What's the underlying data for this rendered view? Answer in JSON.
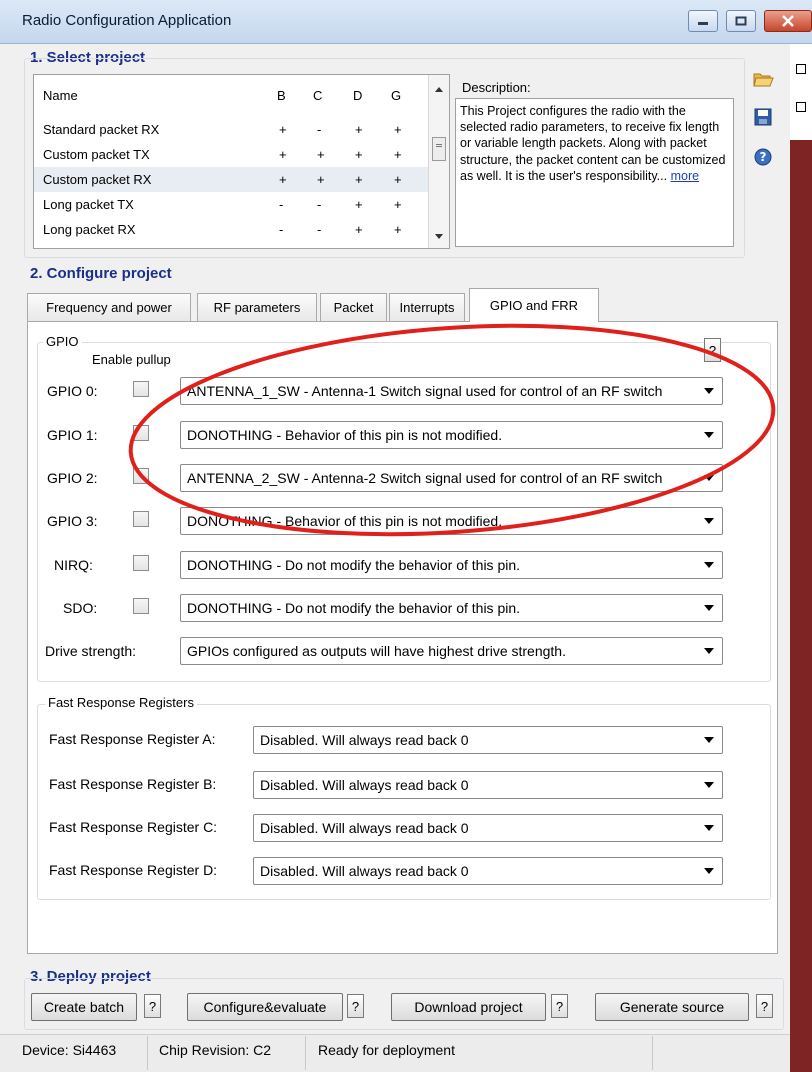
{
  "window": {
    "title": "Radio Configuration Application"
  },
  "section1": {
    "title": "1. Select project"
  },
  "project_list": {
    "headers": [
      "Name",
      "B",
      "C",
      "D",
      "G"
    ],
    "rows": [
      {
        "name": "Standard packet RX",
        "b": "+",
        "c": "-",
        "d": "+",
        "g": "+"
      },
      {
        "name": "Custom packet TX",
        "b": "+",
        "c": "+",
        "d": "+",
        "g": "+"
      },
      {
        "name": "Custom packet RX",
        "b": "+",
        "c": "+",
        "d": "+",
        "g": "+"
      },
      {
        "name": "Long packet TX",
        "b": "-",
        "c": "-",
        "d": "+",
        "g": "+"
      },
      {
        "name": "Long packet RX",
        "b": "-",
        "c": "-",
        "d": "+",
        "g": "+"
      }
    ]
  },
  "description": {
    "label": "Description:",
    "text": "This Project configures the radio with the selected radio parameters, to receive fix length or variable length packets. Along with packet structure, the packet content can be customized as well. It is the user's responsibility...",
    "more": "more"
  },
  "toolbar_icons": [
    "open-folder-icon",
    "save-icon",
    "help-icon"
  ],
  "section2": {
    "title": "2. Configure project"
  },
  "tabs": [
    {
      "label": "Frequency and power"
    },
    {
      "label": "RF parameters"
    },
    {
      "label": "Packet"
    },
    {
      "label": "Interrupts"
    },
    {
      "label": "GPIO and FRR"
    }
  ],
  "gpio": {
    "group_label": "GPIO",
    "enable_pullup_label": "Enable pullup",
    "help": "?",
    "rows": [
      {
        "label": "GPIO 0:",
        "value": "ANTENNA_1_SW - Antenna-1 Switch signal used for control of an RF switch"
      },
      {
        "label": "GPIO 1:",
        "value": "DONOTHING - Behavior of this pin is not modified."
      },
      {
        "label": "GPIO 2:",
        "value": "ANTENNA_2_SW - Antenna-2 Switch signal used for control of an RF switch"
      },
      {
        "label": "GPIO 3:",
        "value": "DONOTHING - Behavior of this pin is not modified."
      },
      {
        "label": "NIRQ:",
        "value": "DONOTHING - Do not modify the behavior of this pin."
      },
      {
        "label": "SDO:",
        "value": "DONOTHING - Do not modify the behavior of this pin."
      }
    ],
    "drive_strength_label": "Drive strength:",
    "drive_strength_value": "GPIOs configured as outputs will have highest drive strength."
  },
  "frr": {
    "group_label": "Fast Response Registers",
    "rows": [
      {
        "label": "Fast Response Register A:",
        "value": "Disabled. Will always read back 0"
      },
      {
        "label": "Fast Response Register B:",
        "value": "Disabled. Will always read back 0"
      },
      {
        "label": "Fast Response Register C:",
        "value": "Disabled. Will always read back 0"
      },
      {
        "label": "Fast Response Register D:",
        "value": "Disabled. Will always read back 0"
      }
    ]
  },
  "section3": {
    "title": "3. Deploy project"
  },
  "deploy_buttons": {
    "create_batch": "Create batch",
    "configure_evaluate": "Configure&evaluate",
    "download_project": "Download project",
    "generate_source": "Generate source",
    "help": "?"
  },
  "status": {
    "device": "Device: Si4463",
    "chip_revision": "Chip Revision: C2",
    "state": "Ready for deployment"
  },
  "colors": {
    "section_title": "#1a2f8a",
    "annotation": "#e0201b",
    "right_strip": "#7e2424"
  }
}
